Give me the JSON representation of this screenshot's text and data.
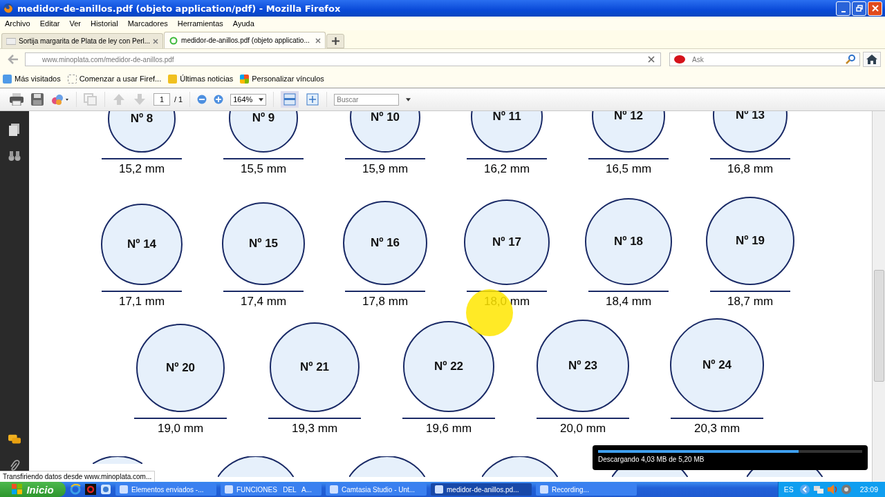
{
  "window": {
    "title": "medidor-de-anillos.pdf (objeto application/pdf) - Mozilla Firefox"
  },
  "menu": [
    "Archivo",
    "Editar",
    "Ver",
    "Historial",
    "Marcadores",
    "Herramientas",
    "Ayuda"
  ],
  "tabs": [
    {
      "label": "Sortija margarita de Plata de ley con Perl...",
      "selected": false
    },
    {
      "label": "medidor-de-anillos.pdf (objeto applicatio...",
      "selected": true
    }
  ],
  "url": "www.minoplata.com/medidor-de-anillos.pdf",
  "search": {
    "placeholder": "Ask"
  },
  "bookmarks": [
    "Más visitados",
    "Comenzar a usar Firef...",
    "Últimas noticias",
    "Personalizar vínculos"
  ],
  "pdf_toolbar": {
    "page": "1",
    "page_count": "/ 1",
    "zoom": "164%",
    "search_placeholder": "Buscar"
  },
  "ring_rows": [
    [
      {
        "label": "Nº 8",
        "size": "15,2 mm"
      },
      {
        "label": "Nº 9",
        "size": "15,5 mm"
      },
      {
        "label": "Nº 10",
        "size": "15,9 mm"
      },
      {
        "label": "Nº 11",
        "size": "16,2 mm"
      },
      {
        "label": "Nº 12",
        "size": "16,5 mm"
      },
      {
        "label": "Nº 13",
        "size": "16,8 mm"
      }
    ],
    [
      {
        "label": "Nº 14",
        "size": "17,1 mm"
      },
      {
        "label": "Nº 15",
        "size": "17,4 mm"
      },
      {
        "label": "Nº 16",
        "size": "17,8 mm"
      },
      {
        "label": "Nº 17",
        "size": "18,0 mm"
      },
      {
        "label": "Nº 18",
        "size": "18,4 mm"
      },
      {
        "label": "Nº 19",
        "size": "18,7 mm"
      }
    ],
    [
      {
        "label": "Nº 20",
        "size": "19,0 mm"
      },
      {
        "label": "Nº 21",
        "size": "19,3 mm"
      },
      {
        "label": "Nº 22",
        "size": "19,6 mm"
      },
      {
        "label": "Nº 23",
        "size": "20,0 mm"
      },
      {
        "label": "Nº 24",
        "size": "20,3 mm"
      }
    ]
  ],
  "status": "Transfiriendo datos desde www.minoplata.com...",
  "download": {
    "text": "Descargando 4,03 MB de 5,20 MB",
    "level": 0.76
  },
  "taskbar": {
    "start": "Inicio",
    "tasks": [
      {
        "label": "Elementos enviados -...",
        "selected": false
      },
      {
        "label": "FUNCIONES   DEL   A...",
        "selected": false
      },
      {
        "label": "Camtasia Studio - Unt...",
        "selected": false
      },
      {
        "label": "medidor-de-anillos.pd...",
        "selected": true
      },
      {
        "label": "Recording...",
        "selected": false
      }
    ],
    "language": "ES",
    "clock": "23:09"
  }
}
